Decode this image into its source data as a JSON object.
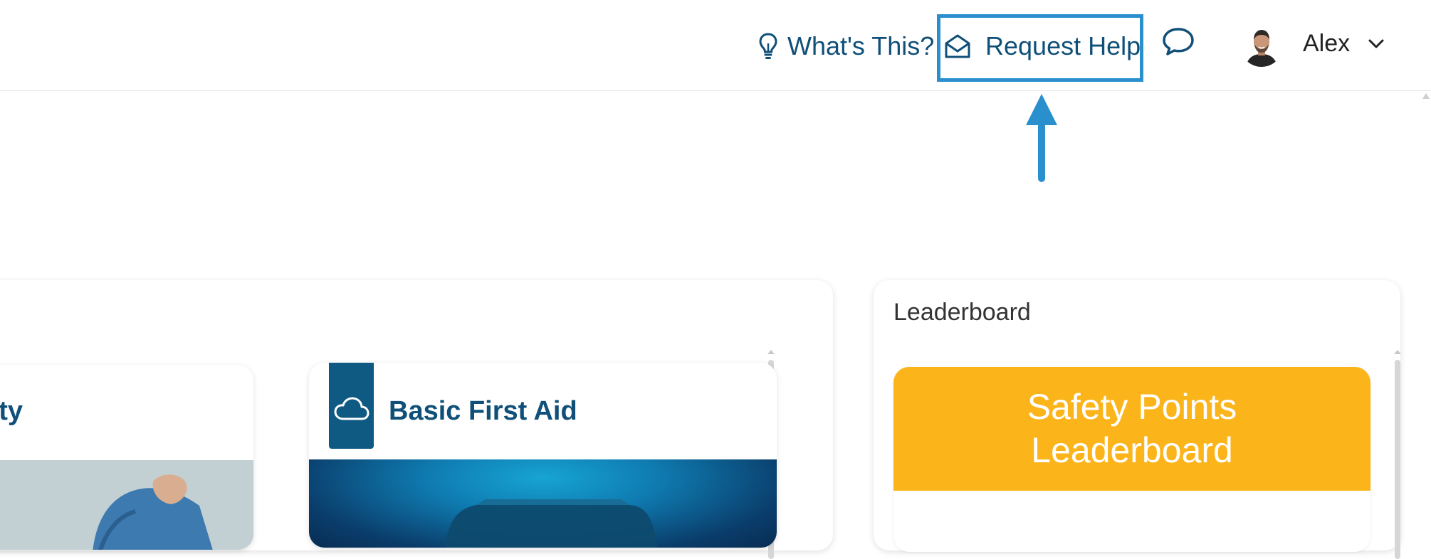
{
  "header": {
    "whats_this_label": "What's This?",
    "request_help_label": "Request Help",
    "user_name": "Alex"
  },
  "courses": {
    "cards": [
      {
        "title": "ty"
      },
      {
        "title": "Basic First Aid"
      }
    ]
  },
  "leaderboard": {
    "title": "Leaderboard",
    "banner_title": "Safety Points Leaderboard"
  },
  "colors": {
    "primary": "#0f4f78",
    "highlight": "#2a8fcd",
    "banner": "#fbb41a",
    "badge": "#0f5a82"
  },
  "icons": {
    "whats_this": "lightbulb-icon",
    "request_help": "envelope-open-icon",
    "chat": "chat-bubble-icon",
    "user_menu": "chevron-down-icon",
    "course_badge": "cloud-icon"
  }
}
